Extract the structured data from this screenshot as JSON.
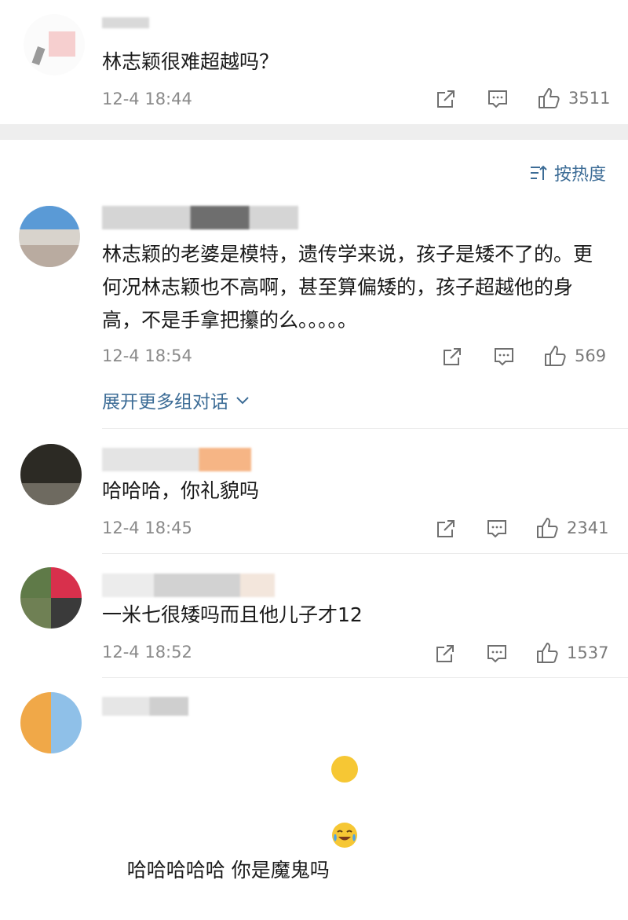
{
  "top_comment": {
    "text": "林志颖很难超越吗？",
    "time": "12-4 18:44",
    "likes": "3511"
  },
  "sort": {
    "label": "按热度"
  },
  "comments": [
    {
      "text": "林志颖的老婆是模特，遗传学来说，孩子是矮不了的。更何况林志颖也不高啊，甚至算偏矮的，孩子超越他的身高，不是手拿把攥的么。。。。。",
      "time": "12-4 18:54",
      "likes": "569",
      "expand_label": "展开更多组对话"
    },
    {
      "text": "哈哈哈，你礼貌吗",
      "time": "12-4 18:45",
      "likes": "2341"
    },
    {
      "text": "一米七很矮吗而且他儿子才12",
      "time": "12-4 18:52",
      "likes": "1537"
    },
    {
      "text": "哈哈哈哈哈 你是魔鬼吗",
      "emoji": "crying-laughing-emoji"
    }
  ],
  "icons": {
    "forward": "share-icon",
    "comment": "comment-icon",
    "like": "thumbs-up-icon",
    "sort": "sort-icon",
    "expand": "chevron-down-icon"
  },
  "colors": {
    "link": "#3c6c96",
    "meta": "#8a8a8a",
    "separator": "#eeeeee"
  }
}
